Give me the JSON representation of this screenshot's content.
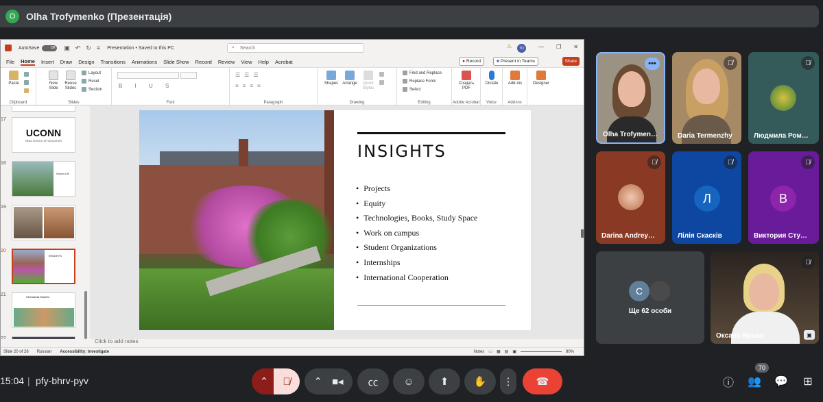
{
  "presenter": {
    "avatar_letter": "O",
    "title": "Olha Trofymenko (Презентація)"
  },
  "ppt": {
    "autosave": "AutoSave",
    "autosave_state": "Off",
    "doc_title": "Presentation • Saved to this PC",
    "search_placeholder": "Search",
    "user_initials": "TO",
    "menu": [
      "File",
      "Home",
      "Insert",
      "Draw",
      "Design",
      "Transitions",
      "Animations",
      "Slide Show",
      "Record",
      "Review",
      "View",
      "Help",
      "Acrobat"
    ],
    "record_label": "Record",
    "teams_label": "Present in Teams",
    "share_label": "Share",
    "ribbon": {
      "paste": "Paste",
      "clipboard": "Clipboard",
      "new_slide": "New Slide",
      "reuse_slides": "Reuse Slides",
      "layout": "Layout",
      "reset": "Reset",
      "section": "Section",
      "slides": "Slides",
      "font": "Font",
      "paragraph": "Paragraph",
      "shapes": "Shapes",
      "arrange": "Arrange",
      "quick_styles": "Quick Styles",
      "drawing": "Drawing",
      "find_replace": "Find and Replace",
      "replace_fonts": "Replace Fonts",
      "select": "Select",
      "editing": "Editing",
      "create_pdf": "Создать PDF",
      "adobe": "Adobe Acrobat",
      "dictate": "Dictate",
      "voice": "Voice",
      "addins": "Add-ins",
      "addins_group": "Add-ins",
      "designer": "Designer"
    },
    "thumb_numbers": [
      "17",
      "18",
      "19",
      "20",
      "21",
      "22"
    ],
    "thumb_uconn": "UCONN",
    "thumb_uconn_sub": "NEAG SCHOOL OF EDUCATION",
    "thumb18_text": "Student Life",
    "thumb20_title": "INSIGHTS",
    "thumb21_title": "International Students",
    "slide": {
      "title": "INSIGHTS",
      "bullets": [
        "Projects",
        "Equity",
        "Technologies, Books, Study Space",
        "Work on campus",
        "Student Organizations",
        "Internships",
        "International Cooperation"
      ]
    },
    "notes_placeholder": "Click to add notes",
    "status": {
      "slide_count": "Slide 20 of 26",
      "language": "Russian",
      "accessibility": "Accessibility: Investigate",
      "notes": "Notes",
      "zoom": "80%"
    }
  },
  "participants": [
    {
      "name": "Olha Trofymen…",
      "muted": false,
      "active": true
    },
    {
      "name": "Daria Termenzhy",
      "muted": true
    },
    {
      "name": "Людмила Ром…",
      "muted": true
    },
    {
      "name": "Darina Andrey…",
      "muted": true
    },
    {
      "name": "Лілія Скасків",
      "muted": true,
      "avatar_letter": "Л"
    },
    {
      "name": "Виктория Сту…",
      "muted": true,
      "avatar_letter": "В"
    },
    {
      "name": "Ще 62 особи",
      "avatar_letter": "С"
    },
    {
      "name": "Оксана Ярова",
      "muted": true
    }
  ],
  "meeting": {
    "time": "15:04",
    "separator": "|",
    "code": "pfy-bhrv-pyv",
    "participant_count": "70"
  },
  "colors": {
    "meet_bg": "#202124",
    "end_call": "#ea4335",
    "ppt_accent": "#c43e1c",
    "speaking": "#8ab4f8"
  }
}
